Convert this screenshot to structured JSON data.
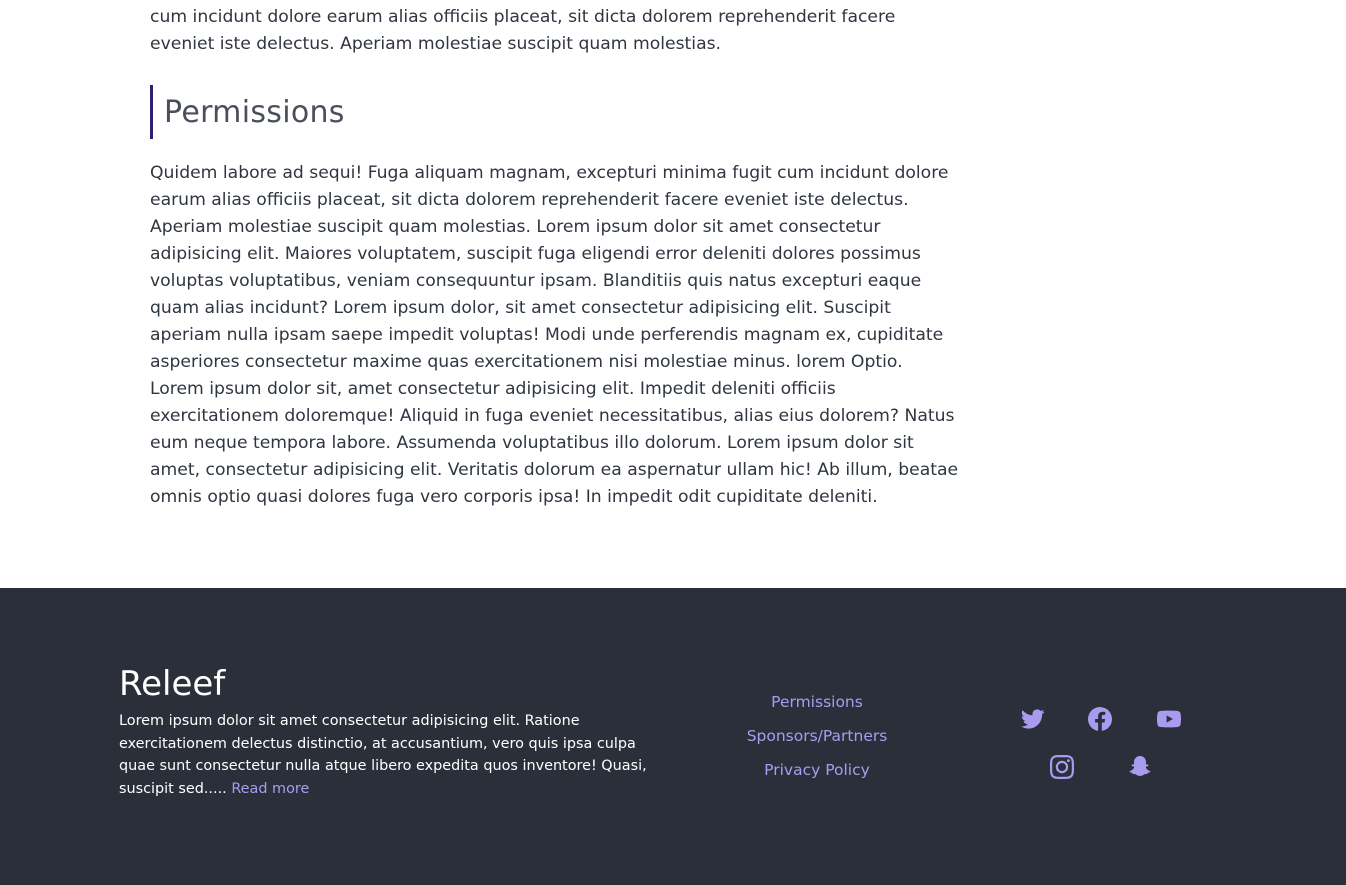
{
  "intro": {
    "text": "cupiditate deleniti. Quidem labore ad sequi! Fuga aliquam magnam, excepturi minima fugit cum incidunt dolore earum alias officiis placeat, sit dicta dolorem reprehenderit facere eveniet iste delectus. Aperiam molestiae suscipit quam molestias."
  },
  "section": {
    "heading": "Permissions",
    "body": "Quidem labore ad sequi! Fuga aliquam magnam, excepturi minima fugit cum incidunt dolore earum alias officiis placeat, sit dicta dolorem reprehenderit facere eveniet iste delectus. Aperiam molestiae suscipit quam molestias. Lorem ipsum dolor sit amet consectetur adipisicing elit. Maiores voluptatem, suscipit fuga eligendi error deleniti dolores possimus voluptas voluptatibus, veniam consequuntur ipsam. Blanditiis quis natus excepturi eaque quam alias incidunt? Lorem ipsum dolor, sit amet consectetur adipisicing elit. Suscipit aperiam nulla ipsam saepe impedit voluptas! Modi unde perferendis magnam ex, cupiditate asperiores consectetur maxime quas exercitationem nisi molestiae minus. lorem Optio. Lorem ipsum dolor sit, amet consectetur adipisicing elit. Impedit deleniti officiis exercitationem doloremque! Aliquid in fuga eveniet necessitatibus, alias eius dolorem? Natus eum neque tempora labore. Assumenda voluptatibus illo dolorum. Lorem ipsum dolor sit amet, consectetur adipisicing elit. Veritatis dolorum ea aspernatur ullam hic! Ab illum, beatae omnis optio quasi dolores fuga vero corporis ipsa! In impedit odit cupiditate deleniti."
  },
  "footer": {
    "brand": "Releef",
    "description": "Lorem ipsum dolor sit amet consectetur adipisicing elit. Ratione exercitationem delectus distinctio, at accusantium, vero quis ipsa culpa quae sunt consectetur nulla atque libero expedita quos inventore! Quasi, suscipit sed.....",
    "read_more": "Read more",
    "links": [
      "Permissions",
      "Sponsors/Partners",
      "Privacy Policy"
    ],
    "social_icons": [
      "twitter-icon",
      "facebook-icon",
      "youtube-icon",
      "instagram-icon",
      "snapchat-icon"
    ],
    "colors": {
      "background": "#2a2f3a",
      "accent": "#a99cf0",
      "heading_border": "#2e1f70"
    }
  }
}
